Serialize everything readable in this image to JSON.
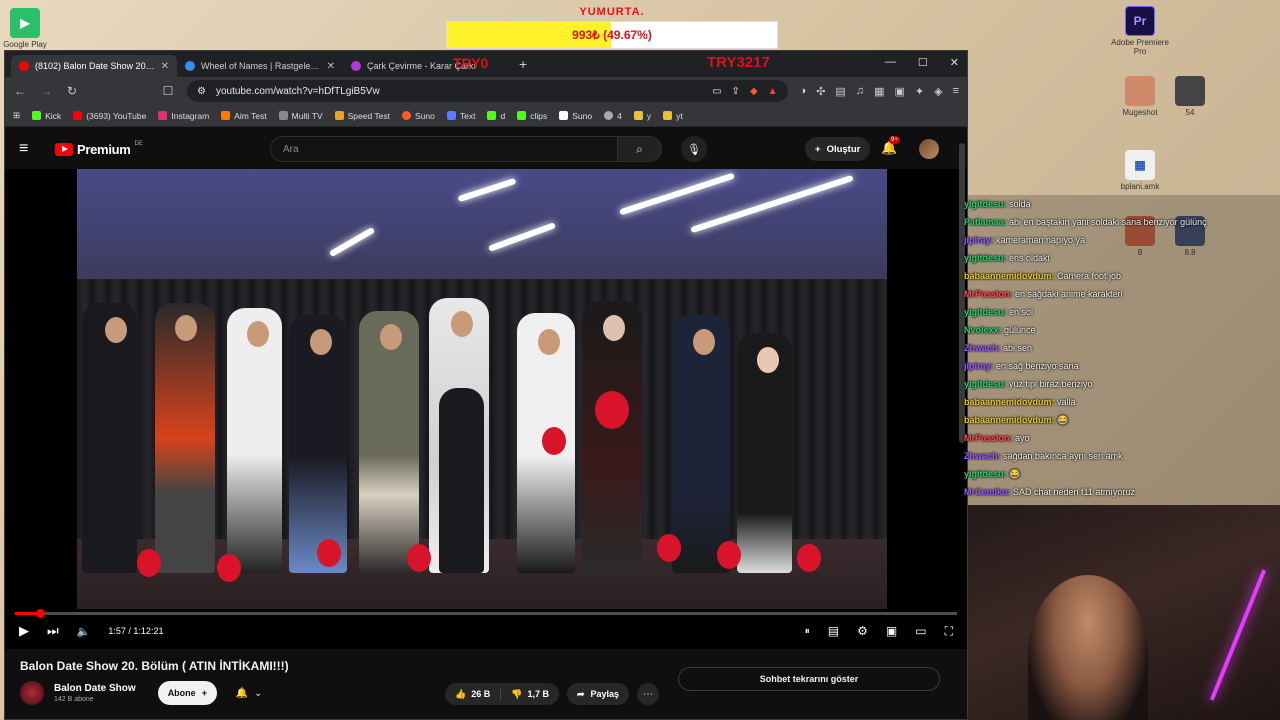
{
  "goal": {
    "title": "YUMURTA.",
    "text": "993₺ (49.67%)",
    "progress": 0.4967
  },
  "desktop": {
    "google_play": "Google Play",
    "premiere": "Adobe Premiere Pro",
    "premiere_glyph": "Pr",
    "mugeshot": "Mugeshot",
    "icon_54": "54",
    "bplani": "bplani.amk",
    "icon_8": "8",
    "icon_88": "8.8"
  },
  "browser": {
    "tabs": [
      {
        "label": "(8102) Balon Date Show 20. Bölü",
        "color": "#ff0000"
      },
      {
        "label": "Wheel of Names | Rastgele ad seçici",
        "color": "#3a8ef0"
      },
      {
        "label": "Çark Çevirme - Karar Çarkı",
        "color": "#b43ad6"
      }
    ],
    "overlay_left": "TRY0",
    "overlay_right": "TRY3217",
    "url": "youtube.com/watch?v=hDfTLgiB5Vw",
    "bookmarks": [
      {
        "label": "Kick",
        "color": "#53fc18"
      },
      {
        "label": "(3693) YouTube",
        "color": "#ff0000"
      },
      {
        "label": "Instagram",
        "color": "#e1306c"
      },
      {
        "label": "Aim Test",
        "color": "#ff7a00"
      },
      {
        "label": "Multi TV",
        "color": "#888888"
      },
      {
        "label": "Speed Test",
        "color": "#e8a32a"
      },
      {
        "label": "Suno",
        "color": "#ff5a1f"
      },
      {
        "label": "Text",
        "color": "#5a7aff"
      },
      {
        "label": "d",
        "color": "#53fc18"
      },
      {
        "label": "clips",
        "color": "#53fc18"
      },
      {
        "label": "Suno",
        "color": "#ffffff"
      },
      {
        "label": "4",
        "color": "#aaaaaa"
      },
      {
        "label": "y",
        "color": "#e8c33a"
      },
      {
        "label": "yt",
        "color": "#e8c33a"
      }
    ]
  },
  "youtube": {
    "logo_text": "Premium",
    "logo_region": "DE",
    "search_placeholder": "Ara",
    "create_label": "Oluştur",
    "notif_badge": "9+",
    "video": {
      "current_time": "1:57",
      "duration": "1:12:21",
      "time_display": "1:57 / 1:12:21",
      "progress": 0.027
    },
    "title": "Balon Date Show 20. Bölüm ( ATIN İNTİKAMI!!!)",
    "channel_name": "Balon Date Show",
    "channel_subs": "142 B abone",
    "subscribe_label": "Abone",
    "likes": "26 B",
    "dislikes": "1,7 B",
    "share_label": "Paylaş",
    "chat_replay_label": "Sohbet tekrarını göster"
  },
  "chat": [
    {
      "user": "yigitdesu:",
      "text": "solda",
      "color": "#2ecc71"
    },
    {
      "user": "Patlamaa:",
      "text": "abi en baştakin yani soldaki sana benziyor gülünç",
      "color": "#2ecc71"
    },
    {
      "user": "jipiray:",
      "text": "kameraman napıyo ya",
      "color": "#9b59ff"
    },
    {
      "user": "yigitdesu:",
      "text": "ens oldaki",
      "color": "#2ecc71"
    },
    {
      "user": "babaannemidovdum:",
      "text": "Camera foot job",
      "color": "#e8c33a"
    },
    {
      "user": "MrPassion:",
      "text": "en sağdaki anime karakteri",
      "color": "#ff4a4a"
    },
    {
      "user": "yigitdesu:",
      "text": "en sol",
      "color": "#2ecc71"
    },
    {
      "user": "Nvolexx:",
      "text": "gülünce",
      "color": "#2ecc71"
    },
    {
      "user": "Zhwach:",
      "text": "abi sen",
      "color": "#9b59ff"
    },
    {
      "user": "jipiray:",
      "text": "en sağ benziyo sana",
      "color": "#9b59ff"
    },
    {
      "user": "yigitdesu:",
      "text": "yüz tipi biraz benziyo",
      "color": "#2ecc71"
    },
    {
      "user": "babaannemidovdum:",
      "text": "valla",
      "color": "#e8c33a"
    },
    {
      "user": "babaannemidovdum:",
      "text": "😂",
      "color": "#e8c33a"
    },
    {
      "user": "MrPassion:",
      "text": "ayo",
      "color": "#ff4a4a"
    },
    {
      "user": "Zhwach:",
      "text": "sağdan bakınca aynı sen amk",
      "color": "#9b59ff"
    },
    {
      "user": "yigitdesu:",
      "text": "😂",
      "color": "#2ecc71"
    },
    {
      "user": "MrCemiko:",
      "text": "SAD chat neden f11 atmıyoruz",
      "color": "#9b59ff"
    }
  ]
}
